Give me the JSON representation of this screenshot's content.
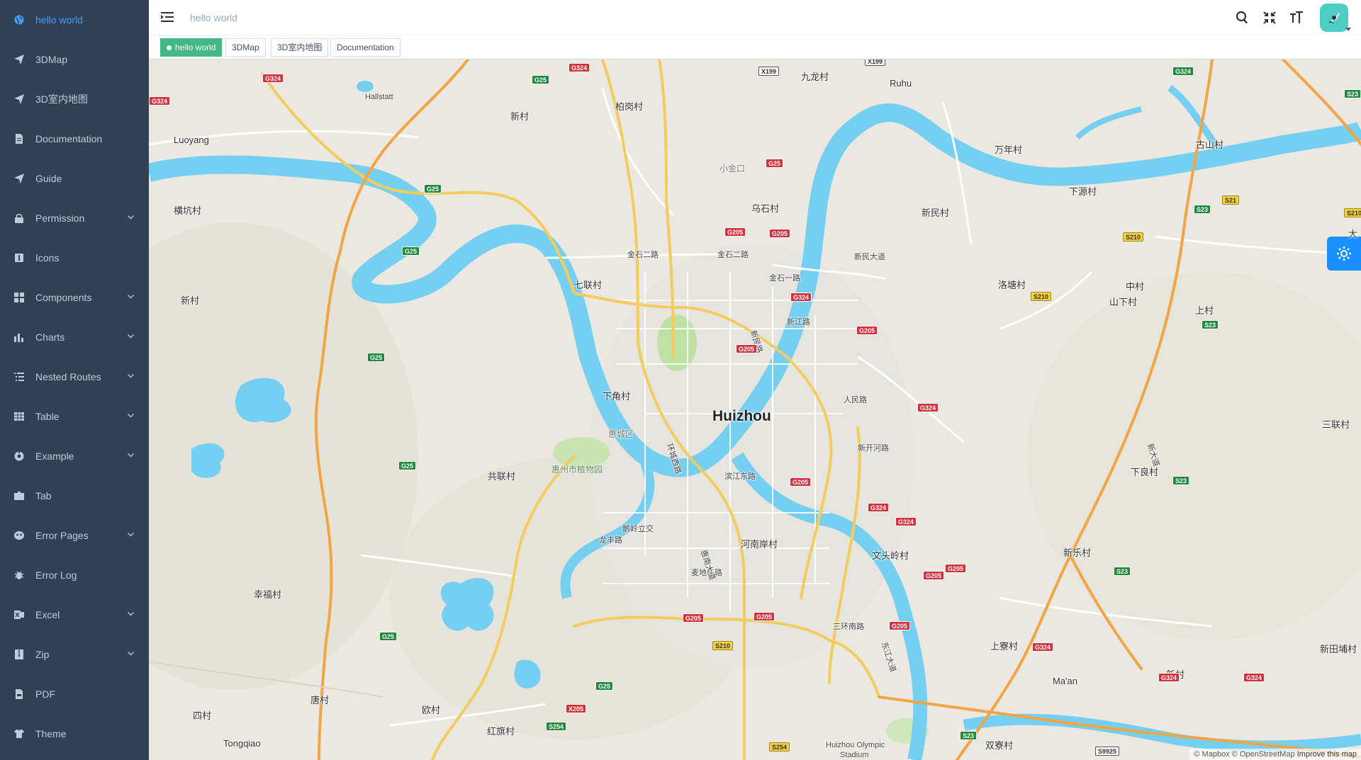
{
  "sidebar": {
    "items": [
      {
        "label": "hello world",
        "icon": "globe-icon",
        "active": true,
        "has_children": false
      },
      {
        "label": "3DMap",
        "icon": "paper-plane-icon",
        "active": false,
        "has_children": false
      },
      {
        "label": "3D室内地图",
        "icon": "paper-plane-icon",
        "active": false,
        "has_children": false
      },
      {
        "label": "Documentation",
        "icon": "document-icon",
        "active": false,
        "has_children": false
      },
      {
        "label": "Guide",
        "icon": "paper-plane-icon",
        "active": false,
        "has_children": false
      },
      {
        "label": "Permission",
        "icon": "lock-icon",
        "active": false,
        "has_children": true
      },
      {
        "label": "Icons",
        "icon": "icon-icon",
        "active": false,
        "has_children": false
      },
      {
        "label": "Components",
        "icon": "components-icon",
        "active": false,
        "has_children": true
      },
      {
        "label": "Charts",
        "icon": "chart-icon",
        "active": false,
        "has_children": true
      },
      {
        "label": "Nested Routes",
        "icon": "nested-icon",
        "active": false,
        "has_children": true
      },
      {
        "label": "Table",
        "icon": "table-icon",
        "active": false,
        "has_children": true
      },
      {
        "label": "Example",
        "icon": "example-icon",
        "active": false,
        "has_children": true
      },
      {
        "label": "Tab",
        "icon": "tab-icon",
        "active": false,
        "has_children": false
      },
      {
        "label": "Error Pages",
        "icon": "error-pages-icon",
        "active": false,
        "has_children": true
      },
      {
        "label": "Error Log",
        "icon": "bug-icon",
        "active": false,
        "has_children": false
      },
      {
        "label": "Excel",
        "icon": "excel-icon",
        "active": false,
        "has_children": true
      },
      {
        "label": "Zip",
        "icon": "zip-icon",
        "active": false,
        "has_children": true
      },
      {
        "label": "PDF",
        "icon": "pdf-icon",
        "active": false,
        "has_children": false
      },
      {
        "label": "Theme",
        "icon": "theme-icon",
        "active": false,
        "has_children": false
      }
    ]
  },
  "navbar": {
    "breadcrumb": "hello world",
    "icons": [
      "search-icon",
      "fullscreen-exit-icon",
      "font-size-icon"
    ]
  },
  "tags": [
    {
      "label": "hello world",
      "active": true
    },
    {
      "label": "3DMap",
      "active": false
    },
    {
      "label": "3D室内地图",
      "active": false
    },
    {
      "label": "Documentation",
      "active": false
    }
  ],
  "map": {
    "city": "Huizhou",
    "places": [
      "Hallstatt",
      "Luoyang",
      "新村",
      "横坑村",
      "新村",
      "柏岗村",
      "九龙村",
      "Ruhu",
      "小金口",
      "乌石村",
      "金石二路",
      "金石二路",
      "金石一路",
      "七联村",
      "新江路",
      "新民大道",
      "新民村",
      "万年村",
      "古山村",
      "下源村",
      "洛塘村",
      "中村",
      "山下村",
      "上村",
      "下角村",
      "惠城区",
      "惠州市植物园",
      "共联村",
      "人民路",
      "三联村",
      "下良村",
      "鹅岭立交",
      "龙丰路",
      "河南岸村",
      "麦地东路",
      "文头岭村",
      "新乐村",
      "幸福村",
      "三环南路",
      "上寮村",
      "Ma'an",
      "新村",
      "新田埔村",
      "唐村",
      "四村",
      "欧村",
      "红旗村",
      "Tongqiao",
      "Huizhou Olympic",
      "Stadium",
      "双寮村",
      "大",
      "新民路",
      "环城西路",
      "滨江东路",
      "惠南大道",
      "东江大道",
      "新开河路",
      "新大道"
    ],
    "shields": [
      "G324",
      "G324",
      "G324",
      "X199",
      "X199",
      "G25",
      "G25",
      "G25",
      "G25",
      "G25",
      "G25",
      "G25",
      "G25",
      "G205",
      "G205",
      "G324",
      "G205",
      "G205",
      "G324",
      "G205",
      "G324",
      "G324",
      "G205",
      "G205",
      "G205",
      "G205",
      "G205",
      "G324",
      "G324",
      "G324",
      "G324",
      "S23",
      "S23",
      "S23",
      "S23",
      "S23",
      "S23",
      "S21",
      "S210",
      "S210",
      "S210",
      "S210",
      "S254",
      "S254",
      "S9925",
      "X205",
      "G324"
    ],
    "attribution": "© Mapbox © OpenStreetMap",
    "improve_link": "Improve this map"
  },
  "colors": {
    "sidebar_bg": "#304156",
    "sidebar_text": "#bfcbd9",
    "sidebar_active": "#409eff",
    "tag_active": "#42b983",
    "water": "#75cff0",
    "road_orange": "#f7a74a",
    "road_yellow": "#f6cf55",
    "settings_button": "#1890ff"
  }
}
